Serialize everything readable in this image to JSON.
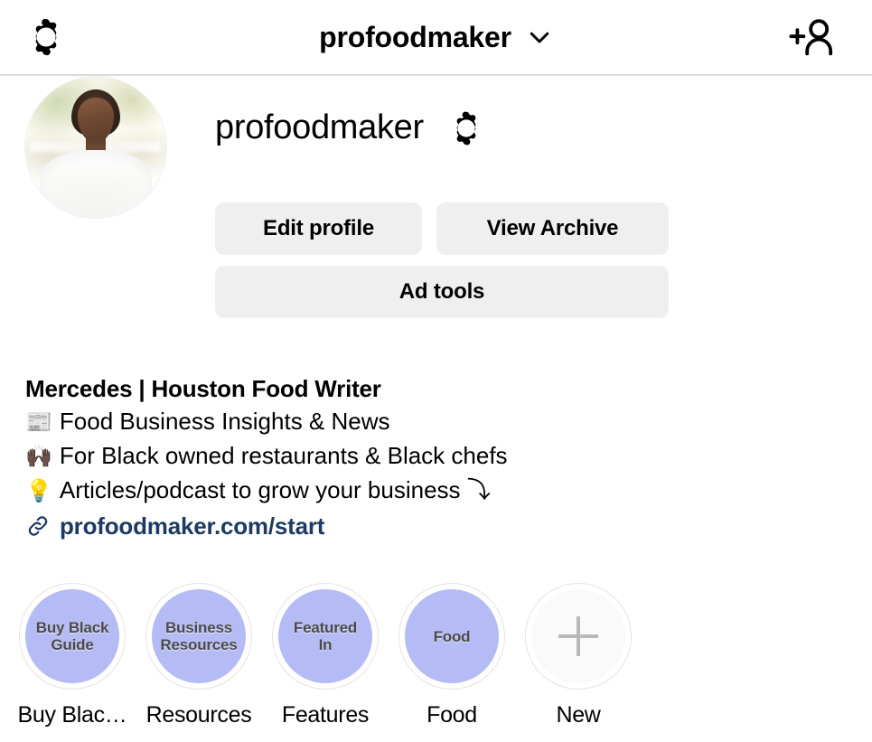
{
  "topbar": {
    "settings_icon": "gear-icon",
    "username": "profoodmaker",
    "chevron_icon": "chevron-down-icon",
    "add_person_icon": "add-person-icon"
  },
  "profile": {
    "avatar_alt": "profile-photo",
    "display_username": "profoodmaker",
    "threads_icon": "gear-icon",
    "buttons": {
      "edit_profile": "Edit profile",
      "view_archive": "View Archive",
      "ad_tools": "Ad tools"
    },
    "bio": {
      "title": "Mercedes | Houston Food Writer",
      "lines": [
        {
          "emoji": "📰",
          "emoji_name": "newspaper-emoji",
          "text": "Food Business Insights & News"
        },
        {
          "emoji": "🙌🏿",
          "emoji_name": "raised-hands-emoji",
          "text": "For Black owned restaurants & Black chefs"
        },
        {
          "emoji": "💡",
          "emoji_name": "light-bulb-emoji",
          "text": "Articles/podcast to grow your business ⤵"
        }
      ],
      "link_icon": "link-icon",
      "link_text": "profoodmaker.com/start"
    }
  },
  "highlights": [
    {
      "cover_text": "Buy Black\nGuide",
      "label": "Buy Blac…",
      "color": "#b5bbf4",
      "type": "highlight"
    },
    {
      "cover_text": "Business\nResources",
      "label": "Resources",
      "color": "#b5bbf4",
      "type": "highlight"
    },
    {
      "cover_text": "Featured\nIn",
      "label": "Features",
      "color": "#b5bbf4",
      "type": "highlight"
    },
    {
      "cover_text": "Food",
      "label": "Food",
      "color": "#b5bbf4",
      "type": "highlight"
    },
    {
      "cover_text": "",
      "label": "New",
      "color": "#fafafa",
      "type": "new"
    }
  ],
  "colors": {
    "link_blue": "#1d3a63",
    "button_gray": "#efefef",
    "highlight_periwinkle": "#b5bbf4",
    "divider": "#dbdbdb"
  }
}
